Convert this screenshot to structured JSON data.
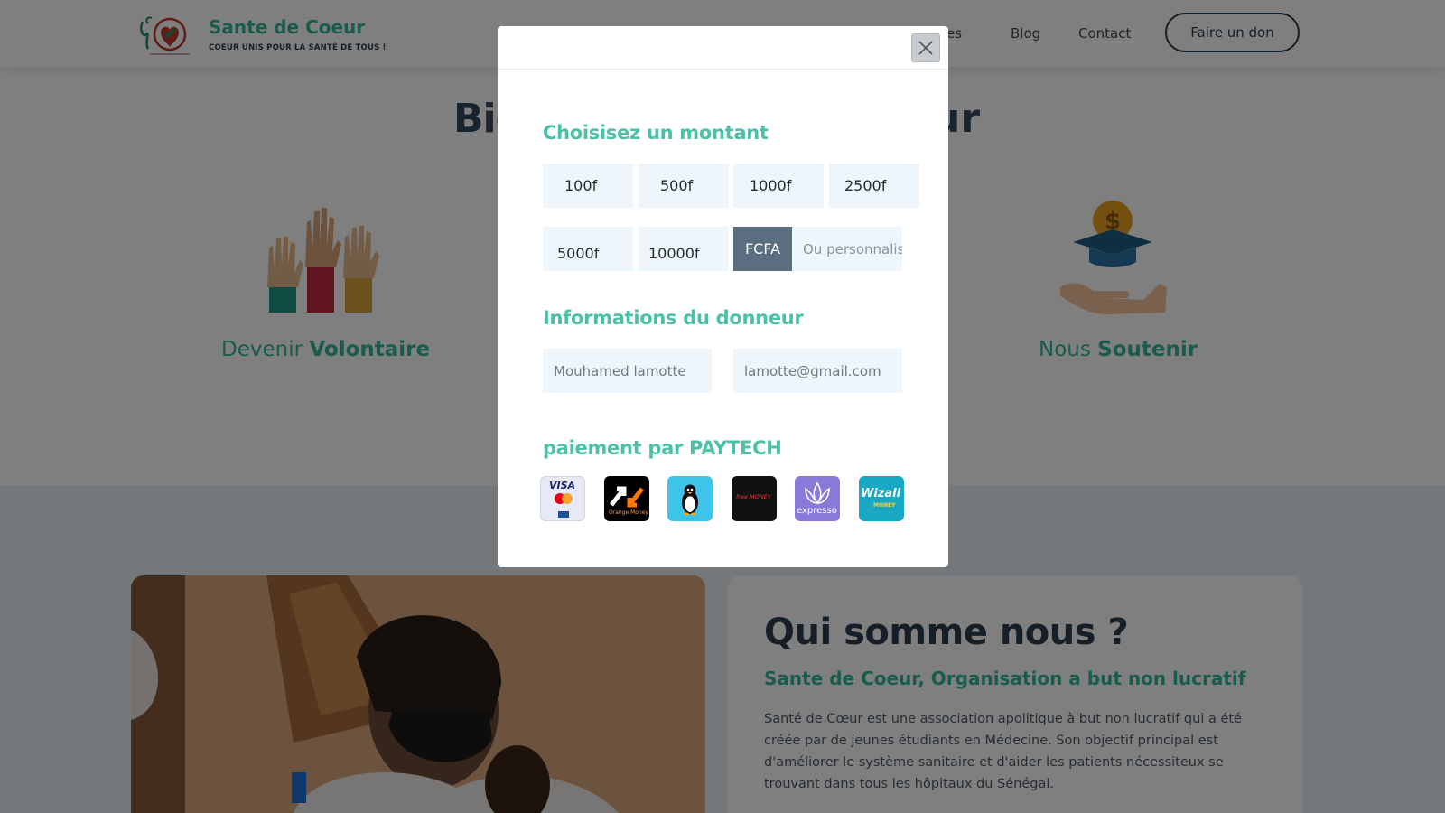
{
  "header": {
    "brand_name": "Sante de Coeur",
    "tagline": "COEUR UNIS POUR LA SANTÉ DE TOUS !",
    "nav_partial": "ires",
    "nav_blog": "Blog",
    "nav_contact": "Contact",
    "donate_label": "Faire un don"
  },
  "hero": {
    "welcome_left": "Bie",
    "welcome_right": "ur",
    "volunteer_prefix": "Devenir",
    "volunteer_strong": "Volontaire",
    "support_prefix": "Nous",
    "support_strong": "Soutenir"
  },
  "about": {
    "title": "Qui somme nous ?",
    "subtitle": "Sante de Coeur, Organisation a but non lucratif",
    "text": "Santé de Cœur est une association apolitique à but non lucratif qui a été créée par de jeunes étudiants en Médecine. Son objectif principal est d'améliorer le système sanitaire et d'aider les patients nécessiteux se trouvant dans tous les hôpitaux du Sénégal."
  },
  "modal": {
    "amount_title": "Choisisez un montant",
    "amounts": [
      "100f",
      "500f",
      "1000f",
      "2500f",
      "5000f",
      "10000f"
    ],
    "currency": "FCFA",
    "custom_placeholder": "Ou personnalisé",
    "donor_title": "Informations du donneur",
    "name_placeholder": "Mouhamed lamotte",
    "email_placeholder": "lamotte@gmail.com",
    "payment_title": "paiement par PAYTECH",
    "payment_logos": {
      "visa": "VISA",
      "orange": "Orange Money",
      "free": "free MONEY",
      "expresso": "expresso",
      "wizall": "Wizall",
      "wizall_sub": "MONEY"
    }
  },
  "colors": {
    "accent": "#33b89a",
    "dark": "#2c3e50",
    "input_bg": "#eef5fb",
    "currency_bg": "#5a6e80"
  }
}
